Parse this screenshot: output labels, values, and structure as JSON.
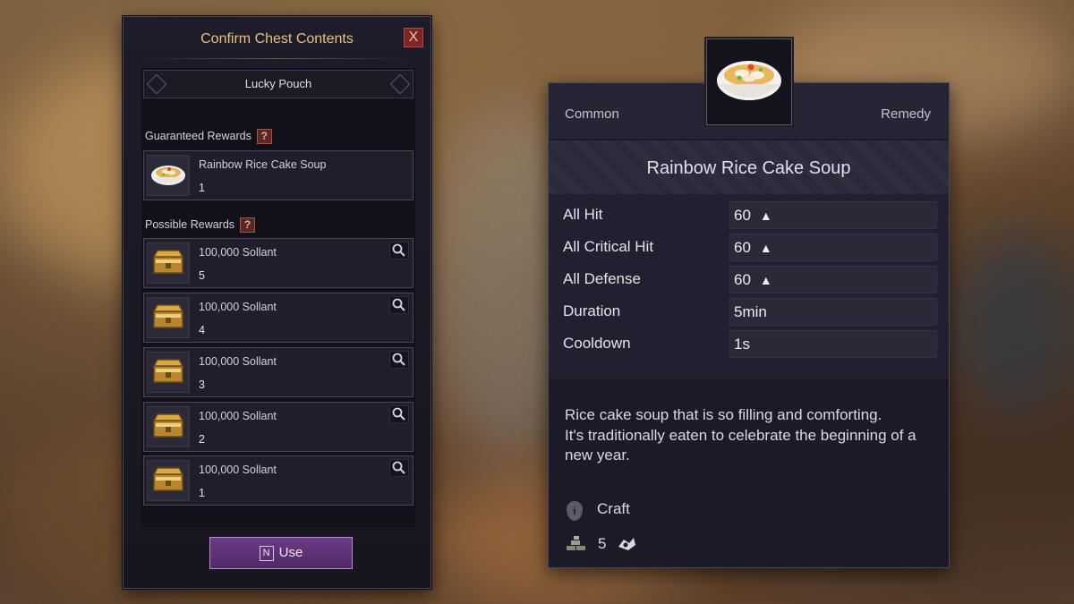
{
  "chest_window": {
    "title": "Confirm Chest Contents",
    "close_label": "X",
    "pouch_name": "Lucky Pouch",
    "guaranteed_label": "Guaranteed Rewards",
    "possible_label": "Possible Rewards",
    "help_glyph": "?",
    "guaranteed": [
      {
        "name": "Rainbow Rice Cake Soup",
        "qty": "1",
        "icon": "rice-cake-soup-icon"
      }
    ],
    "possible": [
      {
        "name": "100,000 Sollant",
        "qty": "5",
        "icon": "gold-chest-icon"
      },
      {
        "name": "100,000 Sollant",
        "qty": "4",
        "icon": "gold-chest-icon"
      },
      {
        "name": "100,000 Sollant",
        "qty": "3",
        "icon": "gold-chest-icon"
      },
      {
        "name": "100,000 Sollant",
        "qty": "2",
        "icon": "gold-chest-icon"
      },
      {
        "name": "100,000 Sollant",
        "qty": "1",
        "icon": "gold-chest-icon"
      }
    ],
    "use_key": "N",
    "use_label": "Use"
  },
  "tooltip": {
    "grade": "Common",
    "category": "Remedy",
    "item_name": "Rainbow Rice Cake Soup",
    "stats": [
      {
        "label": "All Hit",
        "value": "60",
        "arrow": "▲"
      },
      {
        "label": "All Critical Hit",
        "value": "60",
        "arrow": "▲"
      },
      {
        "label": "All Defense",
        "value": "60",
        "arrow": "▲"
      },
      {
        "label": "Duration",
        "value": "5min",
        "arrow": ""
      },
      {
        "label": "Cooldown",
        "value": "1s",
        "arrow": ""
      }
    ],
    "description_lines": [
      "Rice cake soup that is so filling and comforting.",
      "It's traditionally eaten to celebrate the beginning of a new year."
    ],
    "source_label": "Craft",
    "source_glyph": "i",
    "stack_count": "5"
  },
  "colors": {
    "title_gold": "#e8c27a",
    "use_button": "#5e3276",
    "close_red": "#7a2624"
  }
}
